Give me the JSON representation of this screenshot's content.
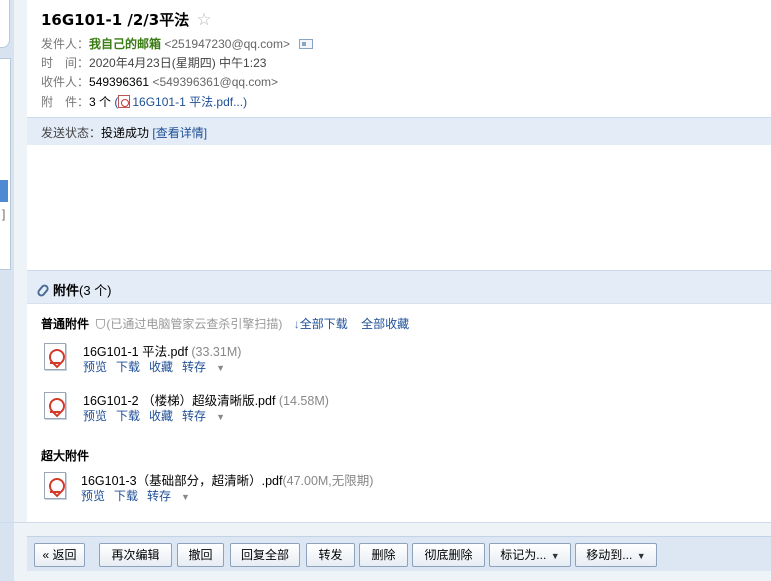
{
  "email": {
    "subject": "16G101-1 /2/3平法",
    "star": "☆",
    "sender_label": "发件人：",
    "sender_name": "我自己的邮箱",
    "sender_addr": "<251947230@qq.com>",
    "time_label": "时　间：",
    "time_value": "2020年4月23日(星期四) 中午1:23",
    "recipient_label": "收件人：",
    "recipient_name": "549396361",
    "recipient_addr": "<549396361@qq.com>",
    "attach_label": "附　件：",
    "attach_count": "3 个",
    "attach_paren_open": " (",
    "attach_first": "16G101-1 平法.pdf...",
    "attach_paren_close": ")",
    "status_label": "发送状态：",
    "status_value": "投递成功",
    "status_link": "[查看详情]"
  },
  "attachments": {
    "header_title": "附件",
    "header_count": "(3 个)",
    "normal_title": "普通附件",
    "scan_note": "(已通过电脑管家云查杀引擎扫描)",
    "download_all": "全部下载",
    "collect_all": "全部收藏",
    "large_title": "超大附件",
    "items": [
      {
        "name": "16G101-1 平法.pdf",
        "size": " (33.31M)",
        "a1": "预览",
        "a2": "下载",
        "a3": "收藏",
        "a4": "转存"
      },
      {
        "name": "16G101-2 （楼梯）超级清晰版.pdf",
        "size": " (14.58M)",
        "a1": "预览",
        "a2": "下载",
        "a3": "收藏",
        "a4": "转存"
      }
    ],
    "large_item": {
      "name": "16G101-3（基础部分，超清晰）.pdf",
      "size": "(47.00M,无限期)",
      "a1": "预览",
      "a2": "下载",
      "a4": "转存"
    }
  },
  "toolbar": {
    "back": "« 返回",
    "reedit": "再次编辑",
    "recall": "撤回",
    "reply_all": "回复全部",
    "forward": "转发",
    "delete": "删除",
    "delete_forever": "彻底删除",
    "mark_as": "标记为...",
    "move_to": "移动到..."
  },
  "colors": {
    "accent": "#1f4f96",
    "sender_green": "#3a7c14",
    "header_bg": "#e3ecf7",
    "pdf_red": "#d23a2a"
  }
}
